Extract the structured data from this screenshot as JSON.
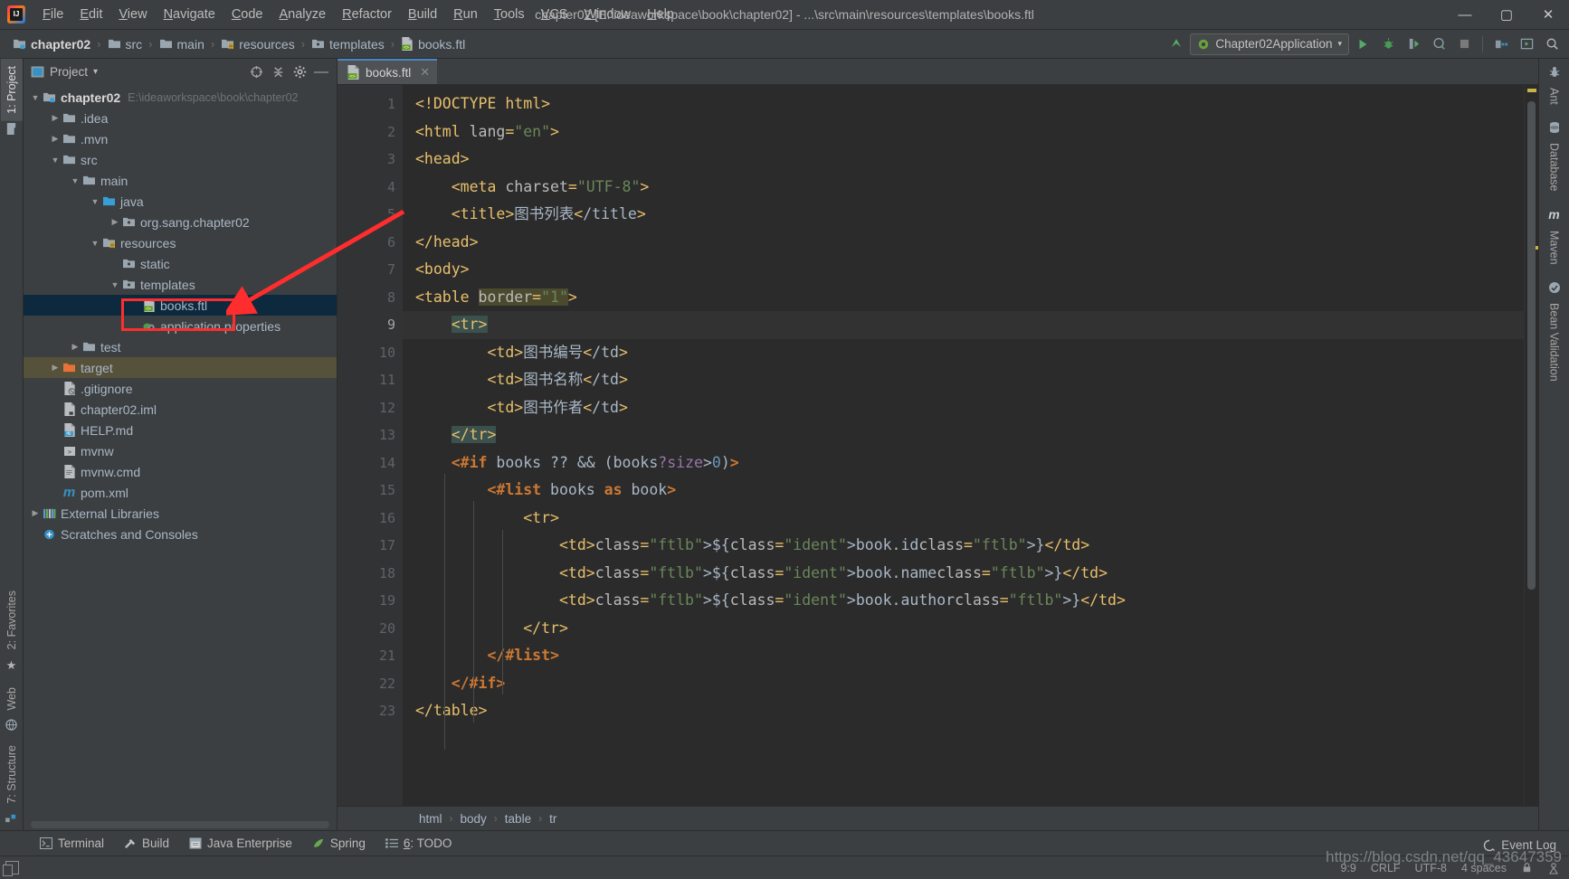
{
  "window": {
    "title": "chapter02 [E:\\ideaworkspace\\book\\chapter02] - ...\\src\\main\\resources\\templates\\books.ftl",
    "minimize": "—",
    "maximize": "▢",
    "close": "✕"
  },
  "menubar": [
    {
      "label": "File"
    },
    {
      "label": "Edit"
    },
    {
      "label": "View"
    },
    {
      "label": "Navigate"
    },
    {
      "label": "Code"
    },
    {
      "label": "Analyze"
    },
    {
      "label": "Refactor"
    },
    {
      "label": "Build"
    },
    {
      "label": "Run"
    },
    {
      "label": "Tools"
    },
    {
      "label": "VCS"
    },
    {
      "label": "Window"
    },
    {
      "label": "Help"
    }
  ],
  "navbar": {
    "crumbs": [
      {
        "label": "chapter02",
        "icon": "module-icon"
      },
      {
        "label": "src",
        "icon": "folder-icon"
      },
      {
        "label": "main",
        "icon": "folder-icon"
      },
      {
        "label": "resources",
        "icon": "resources-folder-icon"
      },
      {
        "label": "templates",
        "icon": "package-folder-icon"
      },
      {
        "label": "books.ftl",
        "icon": "ftl-file-icon"
      }
    ],
    "separator": "›",
    "run_config": "Chapter02Application",
    "run_config_caret": "▾"
  },
  "left_stripe": [
    {
      "label": "1: Project",
      "active": true
    },
    {
      "label": "2: Favorites",
      "active": false
    },
    {
      "label": "Web",
      "active": false
    },
    {
      "label": "7: Structure",
      "active": false
    }
  ],
  "right_stripe": [
    {
      "label": "Ant"
    },
    {
      "label": "Database"
    },
    {
      "label": "Maven"
    },
    {
      "label": "Bean Validation"
    }
  ],
  "project_panel": {
    "title": "Project",
    "caret": "▾",
    "tree": [
      {
        "indent": 0,
        "arrow": "▼",
        "icon": "module-icon",
        "label": "chapter02",
        "bold": true,
        "sub": "E:\\ideaworkspace\\book\\chapter02",
        "state": "none"
      },
      {
        "indent": 1,
        "arrow": "▶",
        "icon": "folder-icon",
        "label": ".idea",
        "bold": false,
        "sub": "",
        "state": "none"
      },
      {
        "indent": 1,
        "arrow": "▶",
        "icon": "folder-icon",
        "label": ".mvn",
        "bold": false,
        "sub": "",
        "state": "none"
      },
      {
        "indent": 1,
        "arrow": "▼",
        "icon": "folder-icon",
        "label": "src",
        "bold": false,
        "sub": "",
        "state": "none"
      },
      {
        "indent": 2,
        "arrow": "▼",
        "icon": "folder-icon",
        "label": "main",
        "bold": false,
        "sub": "",
        "state": "none"
      },
      {
        "indent": 3,
        "arrow": "▼",
        "icon": "sources-folder-icon",
        "label": "java",
        "bold": false,
        "sub": "",
        "state": "none"
      },
      {
        "indent": 4,
        "arrow": "▶",
        "icon": "package-folder-icon",
        "label": "org.sang.chapter02",
        "bold": false,
        "sub": "",
        "state": "none"
      },
      {
        "indent": 3,
        "arrow": "▼",
        "icon": "resources-folder-icon",
        "label": "resources",
        "bold": false,
        "sub": "",
        "state": "none"
      },
      {
        "indent": 4,
        "arrow": "",
        "icon": "package-folder-icon",
        "label": "static",
        "bold": false,
        "sub": "",
        "state": "none"
      },
      {
        "indent": 4,
        "arrow": "▼",
        "icon": "package-folder-icon",
        "label": "templates",
        "bold": false,
        "sub": "",
        "state": "none"
      },
      {
        "indent": 5,
        "arrow": "",
        "icon": "ftl-file-icon",
        "label": "books.ftl",
        "bold": false,
        "sub": "",
        "state": "selected"
      },
      {
        "indent": 5,
        "arrow": "",
        "icon": "properties-file-icon",
        "label": "application.properties",
        "bold": false,
        "sub": "",
        "state": "none"
      },
      {
        "indent": 2,
        "arrow": "▶",
        "icon": "folder-icon",
        "label": "test",
        "bold": false,
        "sub": "",
        "state": "none"
      },
      {
        "indent": 1,
        "arrow": "▶",
        "icon": "target-folder-icon",
        "label": "target",
        "bold": false,
        "sub": "",
        "state": "highlight"
      },
      {
        "indent": 1,
        "arrow": "",
        "icon": "gitignore-file-icon",
        "label": ".gitignore",
        "bold": false,
        "sub": "",
        "state": "none"
      },
      {
        "indent": 1,
        "arrow": "",
        "icon": "iml-file-icon",
        "label": "chapter02.iml",
        "bold": false,
        "sub": "",
        "state": "none"
      },
      {
        "indent": 1,
        "arrow": "",
        "icon": "md-file-icon",
        "label": "HELP.md",
        "bold": false,
        "sub": "",
        "state": "none"
      },
      {
        "indent": 1,
        "arrow": "",
        "icon": "shell-file-icon",
        "label": "mvnw",
        "bold": false,
        "sub": "",
        "state": "none"
      },
      {
        "indent": 1,
        "arrow": "",
        "icon": "cmd-file-icon",
        "label": "mvnw.cmd",
        "bold": false,
        "sub": "",
        "state": "none"
      },
      {
        "indent": 1,
        "arrow": "",
        "icon": "maven-file-icon",
        "label": "pom.xml",
        "bold": false,
        "sub": "",
        "state": "none"
      },
      {
        "indent": 0,
        "arrow": "▶",
        "icon": "libraries-icon",
        "label": "External Libraries",
        "bold": false,
        "sub": "",
        "state": "none"
      },
      {
        "indent": 0,
        "arrow": "",
        "icon": "scratches-icon",
        "label": "Scratches and Consoles",
        "bold": false,
        "sub": "",
        "state": "none"
      }
    ]
  },
  "editor": {
    "tab": {
      "label": "books.ftl",
      "close": "✕"
    },
    "breadcrumbs": [
      "html",
      "body",
      "table",
      "tr"
    ],
    "breadcrumb_separator": "›",
    "current_line": 9,
    "lines": [
      {
        "n": 1,
        "fold": "",
        "bulb": false,
        "text": "<!DOCTYPE html>"
      },
      {
        "n": 2,
        "fold": "▽",
        "bulb": false,
        "text": "<html lang=\"en\">"
      },
      {
        "n": 3,
        "fold": "▽",
        "bulb": false,
        "text": "<head>"
      },
      {
        "n": 4,
        "fold": "",
        "bulb": false,
        "text": "    <meta charset=\"UTF-8\">"
      },
      {
        "n": 5,
        "fold": "",
        "bulb": false,
        "text": "    <title>图书列表</title>"
      },
      {
        "n": 6,
        "fold": "△",
        "bulb": false,
        "text": "</head>"
      },
      {
        "n": 7,
        "fold": "▽",
        "bulb": false,
        "text": "<body>"
      },
      {
        "n": 8,
        "fold": "▽",
        "bulb": false,
        "text": "<table border=\"1\">"
      },
      {
        "n": 9,
        "fold": "▽",
        "bulb": true,
        "text": "    <tr>"
      },
      {
        "n": 10,
        "fold": "",
        "bulb": false,
        "text": "        <td>图书编号</td>"
      },
      {
        "n": 11,
        "fold": "",
        "bulb": false,
        "text": "        <td>图书名称</td>"
      },
      {
        "n": 12,
        "fold": "",
        "bulb": false,
        "text": "        <td>图书作者</td>"
      },
      {
        "n": 13,
        "fold": "△",
        "bulb": false,
        "text": "    </tr>"
      },
      {
        "n": 14,
        "fold": "▽",
        "bulb": false,
        "text": "    <#if books ?? && (books?size>0)>"
      },
      {
        "n": 15,
        "fold": "▽",
        "bulb": false,
        "text": "        <#list books as book>"
      },
      {
        "n": 16,
        "fold": "▽",
        "bulb": false,
        "text": "            <tr>"
      },
      {
        "n": 17,
        "fold": "",
        "bulb": false,
        "text": "                <td>${book.id}</td>"
      },
      {
        "n": 18,
        "fold": "",
        "bulb": false,
        "text": "                <td>${book.name}</td>"
      },
      {
        "n": 19,
        "fold": "",
        "bulb": false,
        "text": "                <td>${book.author}</td>"
      },
      {
        "n": 20,
        "fold": "△",
        "bulb": false,
        "text": "            </tr>"
      },
      {
        "n": 21,
        "fold": "△",
        "bulb": false,
        "text": "        </#list>"
      },
      {
        "n": 22,
        "fold": "△",
        "bulb": false,
        "text": "    </#if>"
      },
      {
        "n": 23,
        "fold": "",
        "bulb": false,
        "text": "</table>"
      }
    ]
  },
  "tool_windows": [
    {
      "label": "Terminal",
      "icon": "terminal-icon"
    },
    {
      "label": "Build",
      "icon": "hammer-icon"
    },
    {
      "label": "Java Enterprise",
      "icon": "java-enterprise-icon"
    },
    {
      "label": "Spring",
      "icon": "spring-leaf-icon"
    },
    {
      "label": "6: TODO",
      "icon": "todo-list-icon"
    }
  ],
  "status_bar": {
    "event_log": "Event Log",
    "caret_position": "9:9",
    "line_separator": "CRLF",
    "encoding": "UTF-8",
    "indent": "4 spaces"
  },
  "watermark": "https://blog.csdn.net/qq_43647359",
  "colors": {
    "accent_blue": "#4a88c7",
    "selection": "#0d293e",
    "annotation_red": "#ff2d2d",
    "run_green": "#59a869",
    "tag_yellow": "#e8bf6a",
    "string_green": "#6a8759",
    "ftl_orange": "#cc7832",
    "number_blue": "#6897bb"
  }
}
